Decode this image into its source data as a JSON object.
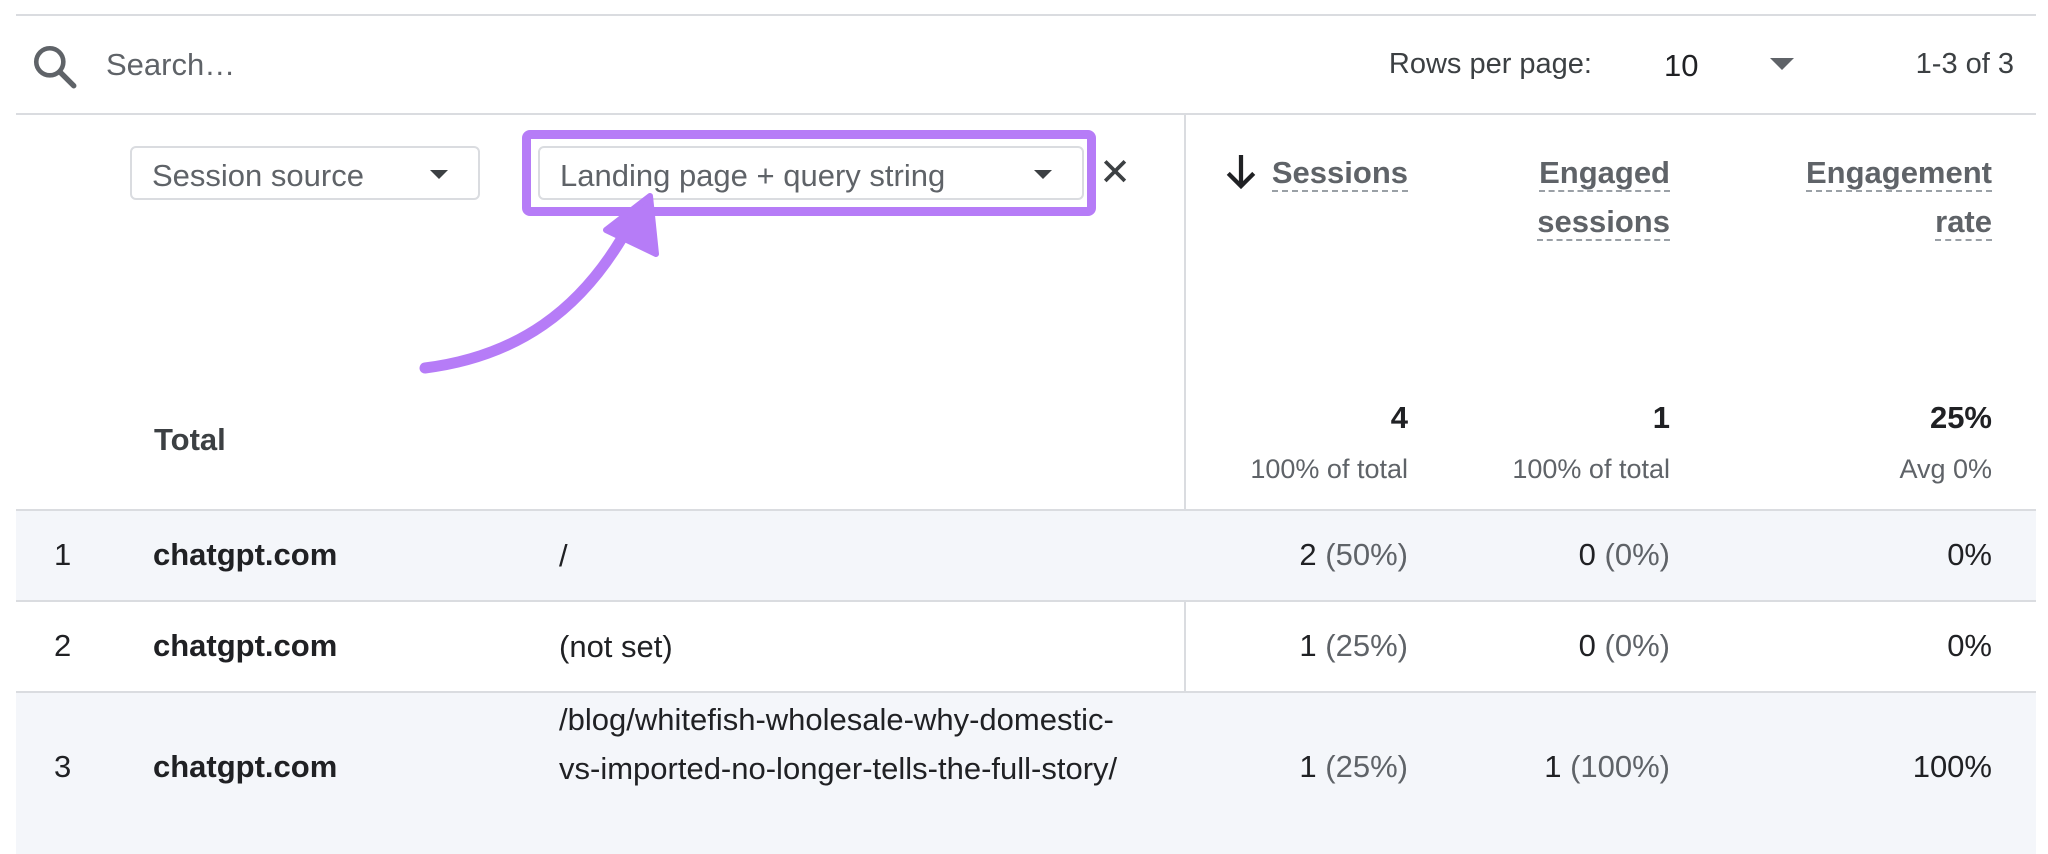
{
  "toolbar": {
    "search_placeholder": "Search…",
    "rows_per_page_label": "Rows per page:",
    "rows_per_page_value": "10",
    "pagination_range": "1-3 of 3"
  },
  "dimensions": {
    "primary": "Session source",
    "secondary": "Landing page + query string",
    "remove_glyph": "✕"
  },
  "metrics": {
    "sessions": "Sessions",
    "engaged_line1": "Engaged",
    "engaged_line2": "sessions",
    "rate_line1": "Engagement",
    "rate_line2": "rate"
  },
  "totals": {
    "label": "Total",
    "sessions": "4",
    "sessions_sub": "100% of total",
    "engaged": "1",
    "engaged_sub": "100% of total",
    "rate": "25%",
    "rate_sub": "Avg 0%"
  },
  "rows": [
    {
      "index": "1",
      "source": "chatgpt.com",
      "page": "/",
      "sessions": "2",
      "sessions_pct": "(50%)",
      "engaged": "0",
      "engaged_pct": "(0%)",
      "rate": "0%"
    },
    {
      "index": "2",
      "source": "chatgpt.com",
      "page": "(not set)",
      "sessions": "1",
      "sessions_pct": "(25%)",
      "engaged": "0",
      "engaged_pct": "(0%)",
      "rate": "0%"
    },
    {
      "index": "3",
      "source": "chatgpt.com",
      "page": "/blog/whitefish-wholesale-why-domestic-vs-imported-no-longer-tells-the-full-story/",
      "sessions": "1",
      "sessions_pct": "(25%)",
      "engaged": "1",
      "engaged_pct": "(100%)",
      "rate": "100%"
    }
  ],
  "colors": {
    "highlight": "#b67cf7",
    "border": "#dadce0",
    "row_alt_bg": "#f4f6fa"
  },
  "icons": {
    "search": "search-icon",
    "dropdown": "caret-down-icon",
    "sort": "arrow-down-icon",
    "annotation": "curved-arrow-icon"
  }
}
